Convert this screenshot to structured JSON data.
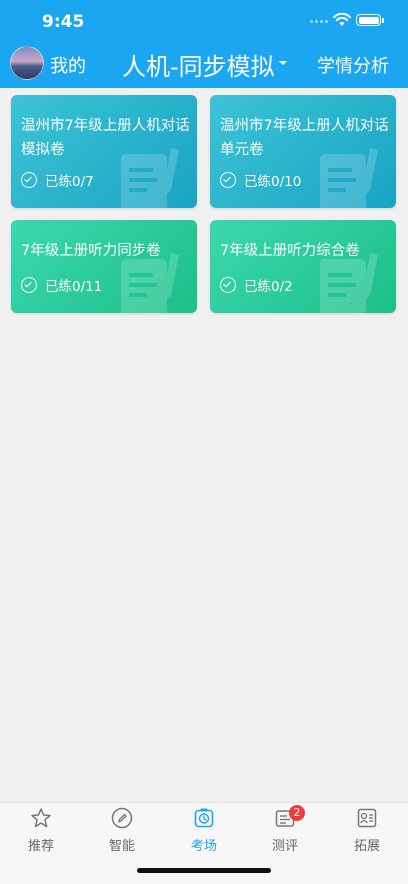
{
  "status_bar": {
    "time": "9:45"
  },
  "header": {
    "me_label": "我的",
    "title": "人机-同步模拟",
    "analysis_label": "学情分析"
  },
  "cards": [
    {
      "title": "温州市7年级上册人机对话\n模拟卷",
      "progress": "已练0/7",
      "color": "blue"
    },
    {
      "title": "温州市7年级上册人机对话\n单元卷",
      "progress": "已练0/10",
      "color": "blue"
    },
    {
      "title": "7年级上册听力同步卷",
      "progress": "已练0/11",
      "color": "green"
    },
    {
      "title": "7年级上册听力综合卷",
      "progress": "已练0/2",
      "color": "green"
    }
  ],
  "tabbar": {
    "items": [
      {
        "label": "推荐",
        "icon": "star-icon"
      },
      {
        "label": "智能",
        "icon": "pencil-circle-icon"
      },
      {
        "label": "考场",
        "icon": "clock-icon",
        "active": true
      },
      {
        "label": "测评",
        "icon": "clipboard-icon",
        "badge": "2"
      },
      {
        "label": "拓展",
        "icon": "profile-card-icon"
      }
    ]
  },
  "colors": {
    "primary": "#1aa6f0",
    "card_blue": "#19a4c4",
    "card_green": "#1cbf8a",
    "badge": "#ef3b3b"
  }
}
